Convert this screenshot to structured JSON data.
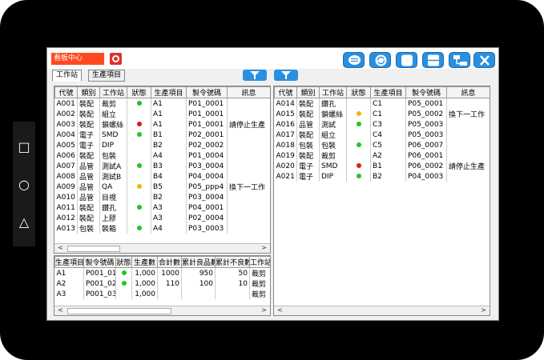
{
  "app": {
    "title": "看板中心",
    "colors": {
      "accent": "#2a8fde",
      "title_bg": "#ff4a1f",
      "status_green": "#22c422",
      "status_red": "#e01818",
      "status_yellow": "#f0b400"
    }
  },
  "nav": {
    "square": "□",
    "circle": "○",
    "triangle": "△"
  },
  "toolbar": {
    "icons": [
      "message-icon",
      "refresh-icon",
      "fullscreen-icon",
      "split-view-icon",
      "tree-view-icon",
      "close-icon"
    ]
  },
  "tabs": [
    {
      "label": "工作站",
      "active": true
    },
    {
      "label": "生產項目",
      "active": false
    }
  ],
  "left_table": {
    "columns": [
      "代號",
      "類別",
      "工作站",
      "狀態",
      "生產項目",
      "製令號碼",
      "訊息"
    ],
    "rows": [
      {
        "code": "A001",
        "cat": "裝配",
        "station": "裁剪",
        "status": "green",
        "item": "A1",
        "order": "P01_0001",
        "msg": ""
      },
      {
        "code": "A002",
        "cat": "裝配",
        "station": "組立",
        "status": "",
        "item": "A1",
        "order": "P01_0001",
        "msg": ""
      },
      {
        "code": "A003",
        "cat": "裝配",
        "station": "鎖螺絲",
        "status": "red",
        "item": "A1",
        "order": "P01_0001",
        "msg": "請停止生產"
      },
      {
        "code": "A004",
        "cat": "電子",
        "station": "SMD",
        "status": "green",
        "item": "B1",
        "order": "P02_0001",
        "msg": ""
      },
      {
        "code": "A005",
        "cat": "電子",
        "station": "DIP",
        "status": "",
        "item": "B2",
        "order": "P02_0002",
        "msg": ""
      },
      {
        "code": "A006",
        "cat": "裝配",
        "station": "包裝",
        "status": "",
        "item": "A4",
        "order": "P01_0004",
        "msg": ""
      },
      {
        "code": "A007",
        "cat": "品管",
        "station": "測試A",
        "status": "green",
        "item": "B3",
        "order": "P03_0004",
        "msg": ""
      },
      {
        "code": "A008",
        "cat": "品管",
        "station": "測試B",
        "status": "",
        "item": "B4",
        "order": "P04_0004",
        "msg": ""
      },
      {
        "code": "A009",
        "cat": "品管",
        "station": "QA",
        "status": "yellow",
        "item": "B5",
        "order": "P05_ppp4",
        "msg": "換下一工作"
      },
      {
        "code": "A010",
        "cat": "品管",
        "station": "目視",
        "status": "",
        "item": "B2",
        "order": "P03_0004",
        "msg": ""
      },
      {
        "code": "A011",
        "cat": "裝配",
        "station": "鑽孔",
        "status": "green",
        "item": "A3",
        "order": "P04_0001",
        "msg": ""
      },
      {
        "code": "A012",
        "cat": "裝配",
        "station": "上膠",
        "status": "",
        "item": "A3",
        "order": "P02_0004",
        "msg": ""
      },
      {
        "code": "A013",
        "cat": "包裝",
        "station": "裝箱",
        "status": "green",
        "item": "A4",
        "order": "P03_0003",
        "msg": ""
      }
    ]
  },
  "right_table": {
    "columns": [
      "代號",
      "類別",
      "工作站",
      "狀態",
      "生產項目",
      "製令號碼",
      "訊息"
    ],
    "rows": [
      {
        "code": "A014",
        "cat": "裝配",
        "station": "鑽孔",
        "status": "",
        "item": "C1",
        "order": "P05_0001",
        "msg": ""
      },
      {
        "code": "A015",
        "cat": "裝配",
        "station": "鎖螺絲",
        "status": "yellow",
        "item": "C1",
        "order": "P05_0002",
        "msg": "換下一工作"
      },
      {
        "code": "A016",
        "cat": "品管",
        "station": "測試",
        "status": "green",
        "item": "C3",
        "order": "P05_0003",
        "msg": ""
      },
      {
        "code": "A017",
        "cat": "裝配",
        "station": "組立",
        "status": "",
        "item": "C4",
        "order": "P05_0003",
        "msg": ""
      },
      {
        "code": "A018",
        "cat": "包裝",
        "station": "包裝",
        "status": "green",
        "item": "C5",
        "order": "P06_0007",
        "msg": ""
      },
      {
        "code": "A019",
        "cat": "裝配",
        "station": "裁剪",
        "status": "",
        "item": "A2",
        "order": "P06_0001",
        "msg": ""
      },
      {
        "code": "A020",
        "cat": "電子",
        "station": "SMD",
        "status": "red",
        "item": "B1",
        "order": "P06_0002",
        "msg": "請停止生產"
      },
      {
        "code": "A021",
        "cat": "電子",
        "station": "DIP",
        "status": "green",
        "item": "B2",
        "order": "P04_0003",
        "msg": ""
      }
    ]
  },
  "bottom_table": {
    "columns": [
      "生產項目",
      "製令號碼",
      "狀態",
      "生產數",
      "合計數",
      "累計良品數",
      "累計不良數",
      "工作站"
    ],
    "rows": [
      {
        "item": "A1",
        "order": "P001_01",
        "status": "green",
        "qty": "1,000",
        "total": "1000",
        "good": "950",
        "bad": "50",
        "station": "裁剪"
      },
      {
        "item": "A2",
        "order": "P001_02",
        "status": "green",
        "qty": "1,000",
        "total": "110",
        "good": "100",
        "bad": "10",
        "station": "裁剪"
      },
      {
        "item": "A3",
        "order": "P001_03",
        "status": "",
        "qty": "1,000",
        "total": "",
        "good": "",
        "bad": "",
        "station": "裁剪"
      }
    ]
  },
  "scroll": {
    "left": "<",
    "right": ">"
  }
}
